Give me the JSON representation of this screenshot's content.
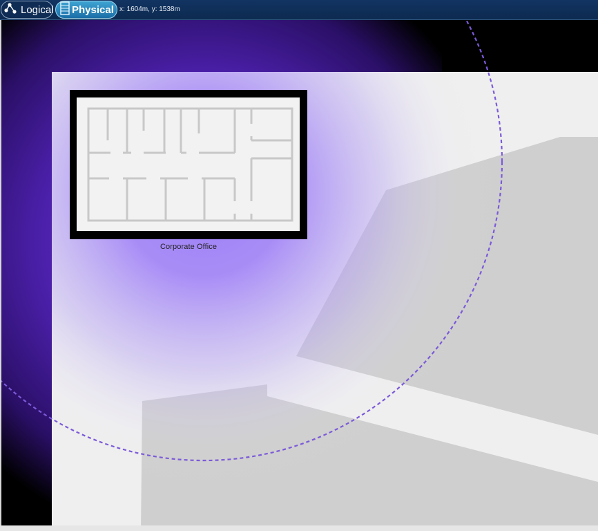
{
  "toolbar": {
    "tabs": [
      {
        "label": "Logical",
        "icon": "network-nodes-icon",
        "active": false
      },
      {
        "label": "Physical",
        "icon": "building-icon",
        "active": true
      }
    ],
    "coordinates": "x: 1604m, y: 1538m"
  },
  "map": {
    "site_label": "Corporate Office",
    "coverage_color": "#9b7ef7",
    "coverage_edge_color": "#7b5ad9",
    "ground_color": "#efefef",
    "building_color": "#cfcfcf"
  }
}
